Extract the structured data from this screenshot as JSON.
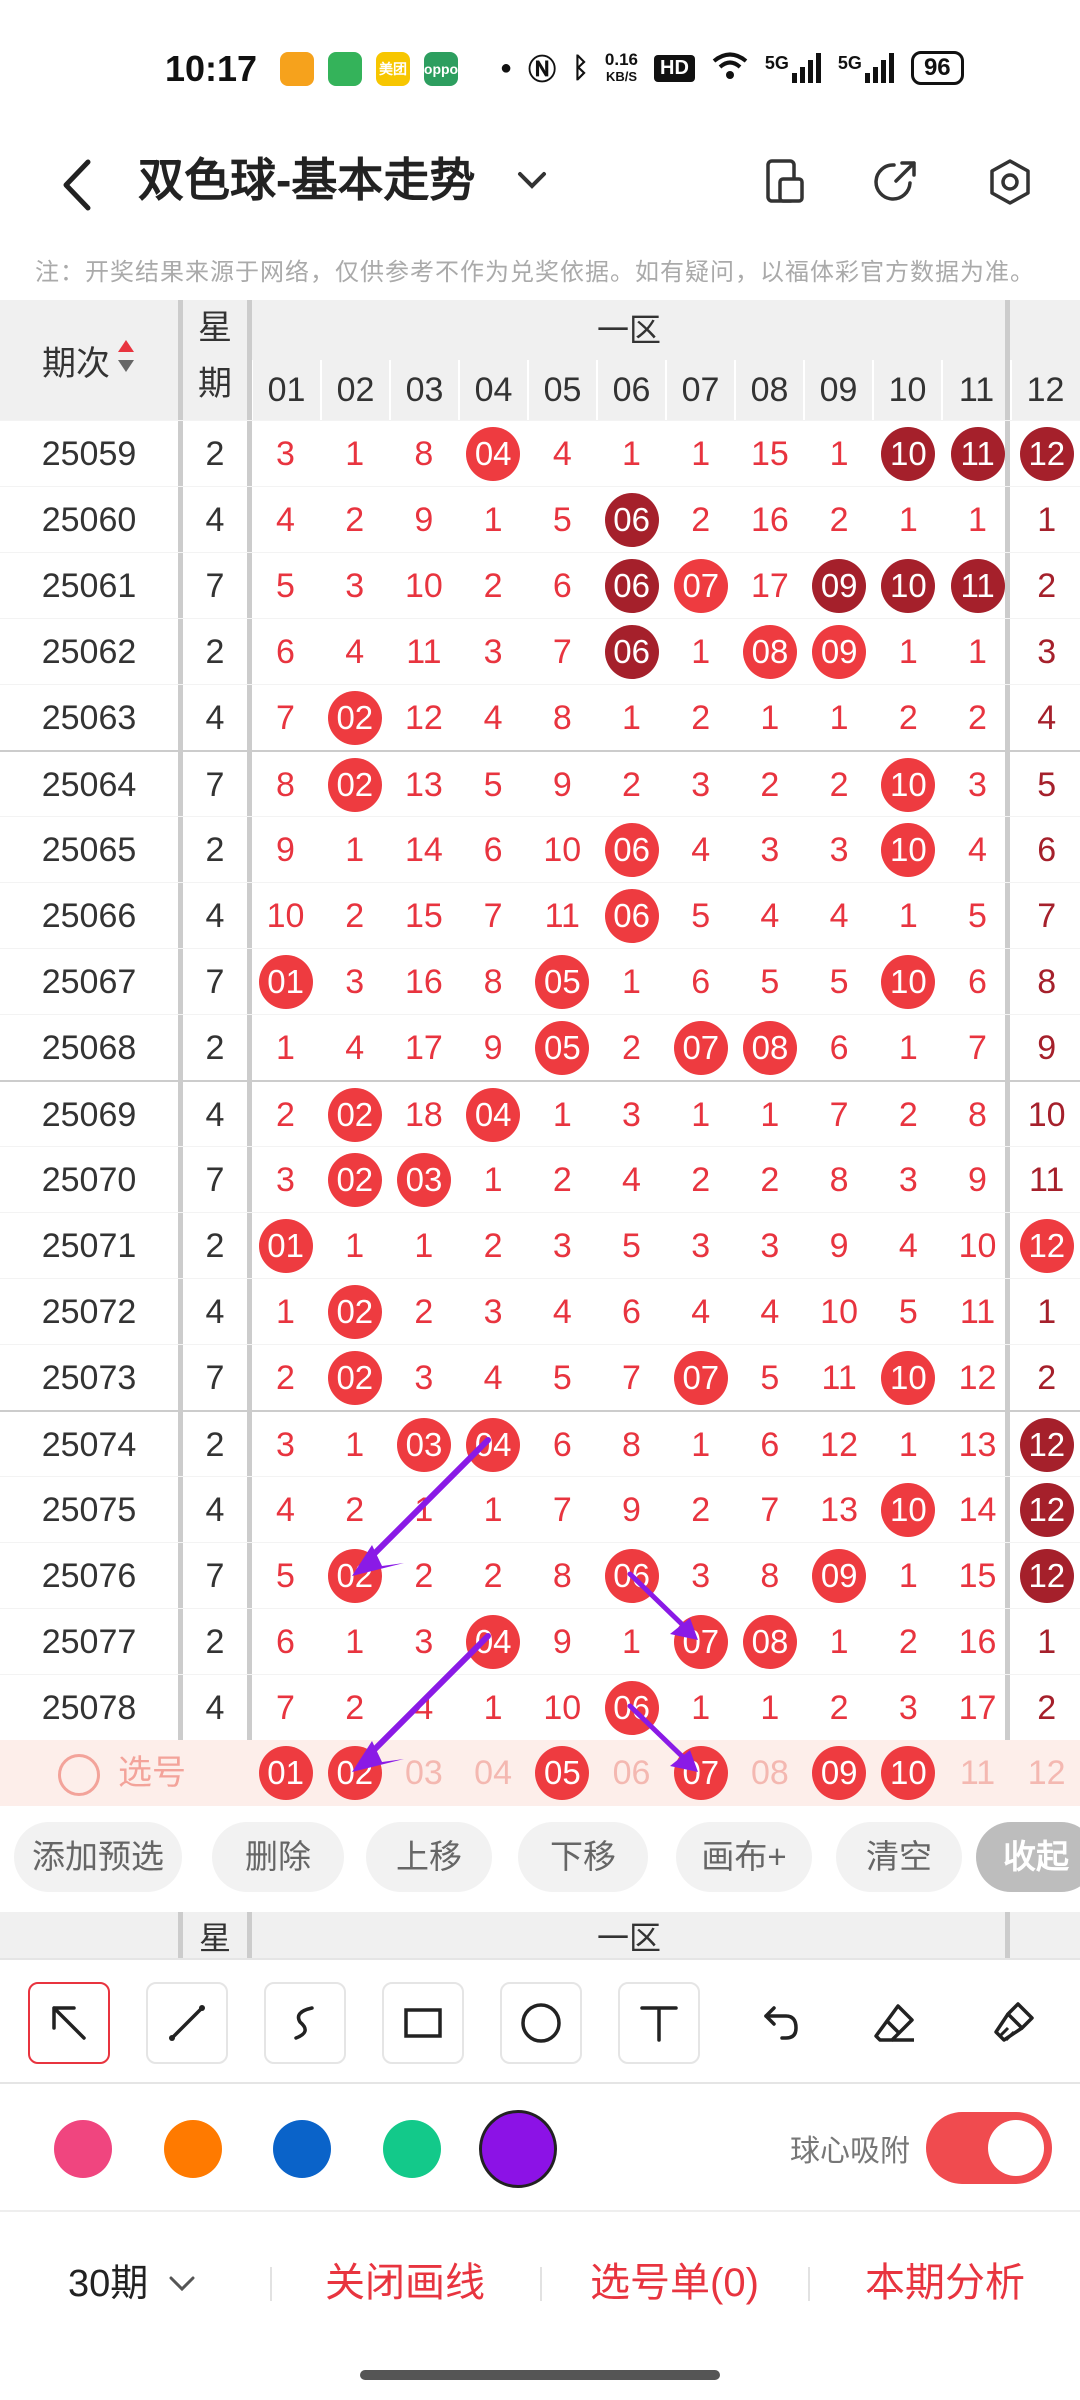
{
  "status_bar": {
    "time": "10:17",
    "app_icons": [
      {
        "name": "app-icon-1",
        "color": "#f6a21c",
        "text": ""
      },
      {
        "name": "app-icon-2",
        "color": "#34b35a",
        "text": ""
      },
      {
        "name": "meituan-icon",
        "color": "#f7c600",
        "text": "美团"
      },
      {
        "name": "oppo-icon",
        "color": "#2d9e5f",
        "text": "oppo"
      }
    ],
    "speed_value": "0.16",
    "speed_unit": "KB/S",
    "hd_label": "HD",
    "network_1": "5G",
    "network_2": "5G",
    "battery": "96"
  },
  "header": {
    "title": "双色球-基本走势"
  },
  "note": "注：开奖结果来源于网络，仅供参考不作为兑奖依据。如有疑问，以福体彩官方数据为准。",
  "table": {
    "period_header": "期次",
    "week_header_1": "星",
    "week_header_2": "期",
    "zone_label": "一区",
    "columns": [
      "01",
      "02",
      "03",
      "04",
      "05",
      "06",
      "07",
      "08",
      "09",
      "10",
      "11",
      "12"
    ],
    "rows": [
      {
        "period": "25059",
        "week": "2",
        "cells": [
          "3",
          "1",
          "8",
          "04",
          "4",
          "1",
          "1",
          "15",
          "1",
          "10",
          "11",
          "12"
        ],
        "hits": [
          "",
          "",
          "",
          "r",
          "",
          "",
          "",
          "",
          "",
          "d",
          "d",
          "d"
        ]
      },
      {
        "period": "25060",
        "week": "4",
        "cells": [
          "4",
          "2",
          "9",
          "1",
          "5",
          "06",
          "2",
          "16",
          "2",
          "1",
          "1",
          "1"
        ],
        "hits": [
          "",
          "",
          "",
          "",
          "",
          "d",
          "",
          "",
          "",
          "",
          "",
          ""
        ]
      },
      {
        "period": "25061",
        "week": "7",
        "cells": [
          "5",
          "3",
          "10",
          "2",
          "6",
          "06",
          "07",
          "17",
          "09",
          "10",
          "11",
          "2"
        ],
        "hits": [
          "",
          "",
          "",
          "",
          "",
          "d",
          "r",
          "",
          "d",
          "d",
          "d",
          ""
        ]
      },
      {
        "period": "25062",
        "week": "2",
        "cells": [
          "6",
          "4",
          "11",
          "3",
          "7",
          "06",
          "1",
          "08",
          "09",
          "1",
          "1",
          "3"
        ],
        "hits": [
          "",
          "",
          "",
          "",
          "",
          "d",
          "",
          "r",
          "r",
          "",
          "",
          ""
        ]
      },
      {
        "period": "25063",
        "week": "4",
        "cells": [
          "7",
          "02",
          "12",
          "4",
          "8",
          "1",
          "2",
          "1",
          "1",
          "2",
          "2",
          "4"
        ],
        "hits": [
          "",
          "r",
          "",
          "",
          "",
          "",
          "",
          "",
          "",
          "",
          "",
          ""
        ]
      },
      {
        "period": "25064",
        "week": "7",
        "cells": [
          "8",
          "02",
          "13",
          "5",
          "9",
          "2",
          "3",
          "2",
          "2",
          "10",
          "3",
          "5"
        ],
        "hits": [
          "",
          "r",
          "",
          "",
          "",
          "",
          "",
          "",
          "",
          "r",
          "",
          ""
        ]
      },
      {
        "period": "25065",
        "week": "2",
        "cells": [
          "9",
          "1",
          "14",
          "6",
          "10",
          "06",
          "4",
          "3",
          "3",
          "10",
          "4",
          "6"
        ],
        "hits": [
          "",
          "",
          "",
          "",
          "",
          "r",
          "",
          "",
          "",
          "r",
          "",
          ""
        ]
      },
      {
        "period": "25066",
        "week": "4",
        "cells": [
          "10",
          "2",
          "15",
          "7",
          "11",
          "06",
          "5",
          "4",
          "4",
          "1",
          "5",
          "7"
        ],
        "hits": [
          "",
          "",
          "",
          "",
          "",
          "r",
          "",
          "",
          "",
          "",
          "",
          ""
        ]
      },
      {
        "period": "25067",
        "week": "7",
        "cells": [
          "01",
          "3",
          "16",
          "8",
          "05",
          "1",
          "6",
          "5",
          "5",
          "10",
          "6",
          "8"
        ],
        "hits": [
          "r",
          "",
          "",
          "",
          "r",
          "",
          "",
          "",
          "",
          "r",
          "",
          ""
        ]
      },
      {
        "period": "25068",
        "week": "2",
        "cells": [
          "1",
          "4",
          "17",
          "9",
          "05",
          "2",
          "07",
          "08",
          "6",
          "1",
          "7",
          "9"
        ],
        "hits": [
          "",
          "",
          "",
          "",
          "r",
          "",
          "r",
          "r",
          "",
          "",
          "",
          ""
        ]
      },
      {
        "period": "25069",
        "week": "4",
        "cells": [
          "2",
          "02",
          "18",
          "04",
          "1",
          "3",
          "1",
          "1",
          "7",
          "2",
          "8",
          "10"
        ],
        "hits": [
          "",
          "r",
          "",
          "r",
          "",
          "",
          "",
          "",
          "",
          "",
          "",
          ""
        ]
      },
      {
        "period": "25070",
        "week": "7",
        "cells": [
          "3",
          "02",
          "03",
          "1",
          "2",
          "4",
          "2",
          "2",
          "8",
          "3",
          "9",
          "11"
        ],
        "hits": [
          "",
          "r",
          "r",
          "",
          "",
          "",
          "",
          "",
          "",
          "",
          "",
          ""
        ]
      },
      {
        "period": "25071",
        "week": "2",
        "cells": [
          "01",
          "1",
          "1",
          "2",
          "3",
          "5",
          "3",
          "3",
          "9",
          "4",
          "10",
          "12"
        ],
        "hits": [
          "r",
          "",
          "",
          "",
          "",
          "",
          "",
          "",
          "",
          "",
          "",
          "r"
        ]
      },
      {
        "period": "25072",
        "week": "4",
        "cells": [
          "1",
          "02",
          "2",
          "3",
          "4",
          "6",
          "4",
          "4",
          "10",
          "5",
          "11",
          "1"
        ],
        "hits": [
          "",
          "r",
          "",
          "",
          "",
          "",
          "",
          "",
          "",
          "",
          "",
          ""
        ]
      },
      {
        "period": "25073",
        "week": "7",
        "cells": [
          "2",
          "02",
          "3",
          "4",
          "5",
          "7",
          "07",
          "5",
          "11",
          "10",
          "12",
          "2"
        ],
        "hits": [
          "",
          "r",
          "",
          "",
          "",
          "",
          "r",
          "",
          "",
          "r",
          "",
          ""
        ]
      },
      {
        "period": "25074",
        "week": "2",
        "cells": [
          "3",
          "1",
          "03",
          "04",
          "6",
          "8",
          "1",
          "6",
          "12",
          "1",
          "13",
          "12"
        ],
        "hits": [
          "",
          "",
          "r",
          "r",
          "",
          "",
          "",
          "",
          "",
          "",
          "",
          "d"
        ]
      },
      {
        "period": "25075",
        "week": "4",
        "cells": [
          "4",
          "2",
          "1",
          "1",
          "7",
          "9",
          "2",
          "7",
          "13",
          "10",
          "14",
          "12"
        ],
        "hits": [
          "",
          "",
          "",
          "",
          "",
          "",
          "",
          "",
          "",
          "r",
          "",
          "d"
        ]
      },
      {
        "period": "25076",
        "week": "7",
        "cells": [
          "5",
          "02",
          "2",
          "2",
          "8",
          "06",
          "3",
          "8",
          "09",
          "1",
          "15",
          "12"
        ],
        "hits": [
          "",
          "r",
          "",
          "",
          "",
          "r",
          "",
          "",
          "r",
          "",
          "",
          "d"
        ]
      },
      {
        "period": "25077",
        "week": "2",
        "cells": [
          "6",
          "1",
          "3",
          "04",
          "9",
          "1",
          "07",
          "08",
          "1",
          "2",
          "16",
          "1"
        ],
        "hits": [
          "",
          "",
          "",
          "r",
          "",
          "",
          "r",
          "r",
          "",
          "",
          "",
          ""
        ]
      },
      {
        "period": "25078",
        "week": "4",
        "cells": [
          "7",
          "2",
          "4",
          "1",
          "10",
          "06",
          "1",
          "1",
          "2",
          "3",
          "17",
          "2"
        ],
        "hits": [
          "",
          "",
          "",
          "",
          "",
          "r",
          "",
          "",
          "",
          "",
          "",
          ""
        ]
      }
    ],
    "select_row": {
      "label": "选号",
      "cells": [
        "01",
        "02",
        "03",
        "04",
        "05",
        "06",
        "07",
        "08",
        "09",
        "10",
        "11",
        "12"
      ],
      "selected": [
        true,
        true,
        false,
        false,
        true,
        false,
        true,
        false,
        true,
        true,
        false,
        false
      ]
    }
  },
  "chips": [
    "添加预选",
    "删除",
    "上移",
    "下移",
    "画布+",
    "清空",
    "收起"
  ],
  "second_header": {
    "week": "星",
    "zone": "一区"
  },
  "tools": [
    "arrow-tool",
    "line-tool",
    "curve-tool",
    "rectangle-tool",
    "circle-tool",
    "text-tool",
    "undo",
    "eraser",
    "clear-brush"
  ],
  "palette": {
    "colors": [
      "#f0457f",
      "#ff7a00",
      "#0a63c9",
      "#13c98a",
      "#8c12e6"
    ],
    "selected_index": 4,
    "snap_label": "球心吸附",
    "snap_on": true
  },
  "bottom_bar": {
    "periods": "30期",
    "close_draw": "关闭画线",
    "selection": "选号单(0)",
    "analysis": "本期分析"
  }
}
